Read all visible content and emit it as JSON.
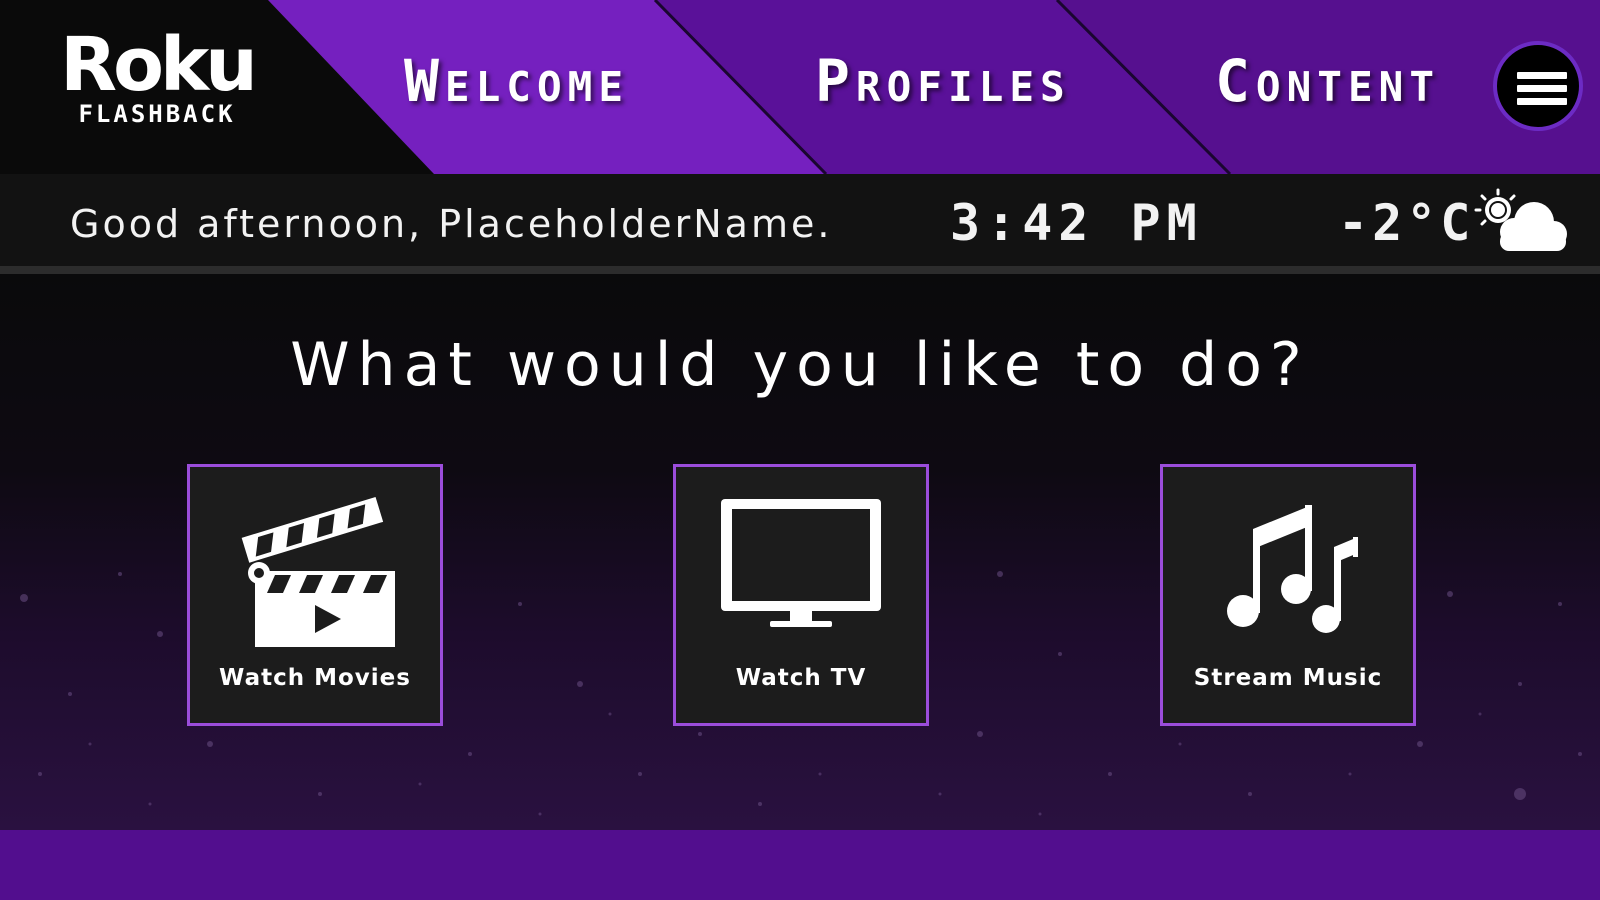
{
  "brand": {
    "name": "Roku",
    "subtitle": "FLASHBACK"
  },
  "nav": {
    "items": [
      {
        "label": "Welcome"
      },
      {
        "label": "Profiles"
      },
      {
        "label": "Content"
      }
    ],
    "menu_icon": "hamburger-menu-icon"
  },
  "status": {
    "greeting": "Good afternoon, PlaceholderName.",
    "time": "3:42 PM",
    "temperature": "-2°C",
    "weather_icon": "partly-cloudy-icon"
  },
  "main": {
    "prompt": "What would you like to do?",
    "tiles": [
      {
        "label": "Watch Movies",
        "icon": "clapperboard-icon"
      },
      {
        "label": "Watch TV",
        "icon": "television-icon"
      },
      {
        "label": "Stream Music",
        "icon": "music-notes-icon"
      }
    ]
  },
  "colors": {
    "accent_purple": "#7a22c4",
    "tile_border": "#9b4ddb",
    "footer": "#520e8e",
    "background": "#0b0b0c"
  }
}
